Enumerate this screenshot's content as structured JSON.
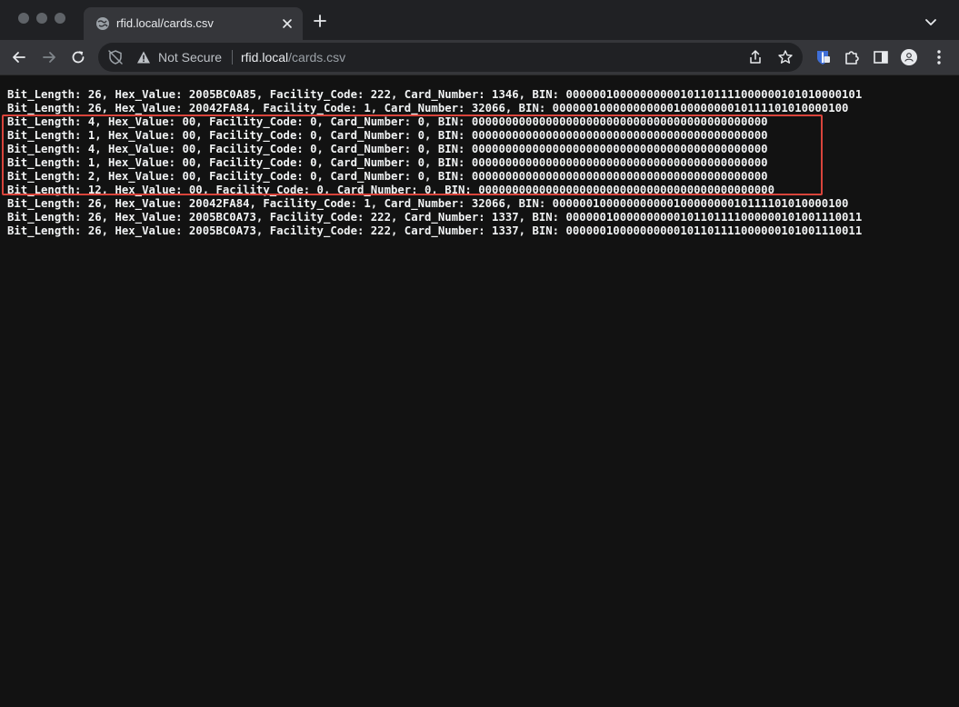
{
  "tab": {
    "title": "rfid.local/cards.csv",
    "favicon": "globe-icon"
  },
  "toolbar": {
    "security_label": "Not Secure",
    "url_host": "rfid.local",
    "url_path": "/cards.csv"
  },
  "file": {
    "lines": [
      "Bit_Length: 26, Hex_Value: 2005BC0A85, Facility_Code: 222, Card_Number: 1346, BIN: 00000010000000000101101111000000101010000101",
      "Bit_Length: 26, Hex_Value: 20042FA84, Facility_Code: 1, Card_Number: 32066, BIN: 00000010000000000010000000010111101010000100",
      "Bit_Length: 4, Hex_Value: 00, Facility_Code: 0, Card_Number: 0, BIN: 00000000000000000000000000000000000000000000",
      "Bit_Length: 1, Hex_Value: 00, Facility_Code: 0, Card_Number: 0, BIN: 00000000000000000000000000000000000000000000",
      "Bit_Length: 4, Hex_Value: 00, Facility_Code: 0, Card_Number: 0, BIN: 00000000000000000000000000000000000000000000",
      "Bit_Length: 1, Hex_Value: 00, Facility_Code: 0, Card_Number: 0, BIN: 00000000000000000000000000000000000000000000",
      "Bit_Length: 2, Hex_Value: 00, Facility_Code: 0, Card_Number: 0, BIN: 00000000000000000000000000000000000000000000",
      "Bit_Length: 12, Hex_Value: 00, Facility_Code: 0, Card_Number: 0, BIN: 00000000000000000000000000000000000000000000",
      "Bit_Length: 26, Hex_Value: 20042FA84, Facility_Code: 1, Card_Number: 32066, BIN: 00000010000000000010000000010111101010000100",
      "Bit_Length: 26, Hex_Value: 2005BC0A73, Facility_Code: 222, Card_Number: 1337, BIN: 00000010000000000101101111000000101001110011",
      "Bit_Length: 26, Hex_Value: 2005BC0A73, Facility_Code: 222, Card_Number: 1337, BIN: 00000010000000000101101111000000101001110011"
    ]
  },
  "colors": {
    "highlight_border": "#d9443b",
    "page_background": "#121212",
    "text": "#f1f3f4"
  }
}
